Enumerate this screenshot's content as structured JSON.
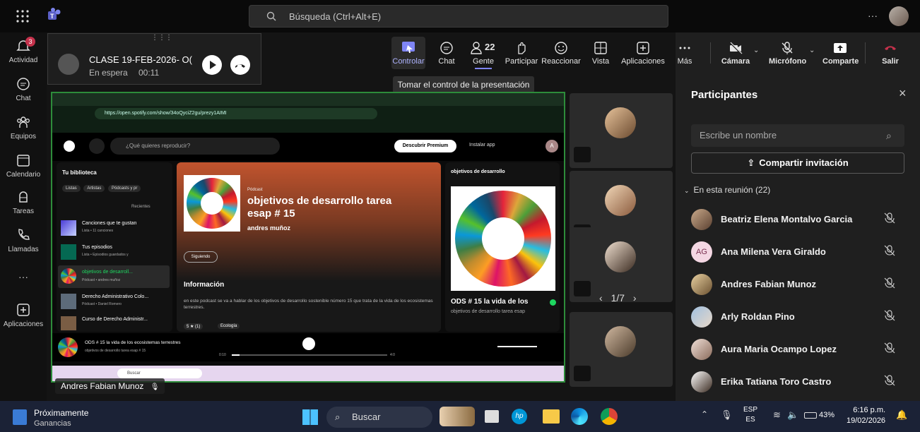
{
  "topbar": {
    "search_placeholder": "Búsqueda (Ctrl+Alt+E)",
    "more": "···"
  },
  "rail": {
    "items": [
      {
        "label": "Actividad",
        "badge": "3"
      },
      {
        "label": "Chat"
      },
      {
        "label": "Equipos"
      },
      {
        "label": "Calendario"
      },
      {
        "label": "Tareas"
      },
      {
        "label": "Llamadas"
      },
      {
        "label": "···"
      },
      {
        "label": "Aplicaciones"
      }
    ]
  },
  "held_call": {
    "title": "CLASE 19-FEB-2026- O(",
    "status": "En espera",
    "timer": "00:11"
  },
  "call_controls": {
    "controlar": "Controlar",
    "chat": "Chat",
    "gente": "Gente",
    "gente_count": "22",
    "participar": "Participar",
    "reaccionar": "Reaccionar",
    "vista": "Vista",
    "aplicaciones": "Aplicaciones",
    "mas": "Más",
    "camara": "Cámara",
    "microfono": "Micrófono",
    "comparte": "Comparte",
    "salir": "Salir",
    "tooltip": "Tomar el control de la presentación"
  },
  "presenter_label": "Andres Fabian Munoz",
  "gallery": {
    "page": "1/7"
  },
  "participants": {
    "title": "Participantes",
    "search_placeholder": "Escribe un nombre",
    "invite": "Compartir invitación",
    "section": "En esta reunión (22)",
    "list": [
      {
        "name": "Beatriz Elena Montalvo Garcia",
        "initials": ""
      },
      {
        "name": "Ana Milena Vera Giraldo",
        "initials": "AG"
      },
      {
        "name": "Andres Fabian Munoz",
        "initials": ""
      },
      {
        "name": "Arly Roldan Pino",
        "initials": ""
      },
      {
        "name": "Aura Maria Ocampo Lopez",
        "initials": ""
      },
      {
        "name": "Erika Tatiana Toro Castro",
        "initials": ""
      }
    ]
  },
  "shared_screen": {
    "url": "https://open.spotify.com/show/34oQyciZ2gu/prezy1AIMI",
    "search_placeholder": "¿Qué quieres reproducir?",
    "premium": "Descubrir Premium",
    "install": "Instalar app",
    "library_title": "Tu biblioteca",
    "filters": [
      "Listas",
      "Artistas",
      "Pódcasts y pr"
    ],
    "recent": "Recientes",
    "library": [
      {
        "title": "Canciones que te gustan",
        "sub": "Lista • 11 canciones"
      },
      {
        "title": "Tus episodios",
        "sub": "Lista • Episodios guardados y"
      },
      {
        "title": "objetivos de desarroll...",
        "sub": "Pódcast • andres muñoz"
      },
      {
        "title": "Derecho Administrativo Colo...",
        "sub": "Pódcast • Daniel Romero"
      },
      {
        "title": "Curso de Derecho Administr...",
        "sub": ""
      }
    ],
    "podcast_kind": "Pódcast",
    "podcast_title": "objetivos de desarrollo tarea esap # 15",
    "podcast_author": "andres muñoz",
    "following": "Siguiendo",
    "info_title": "Información",
    "info_text": "en este podcast se va a hablar de los objetivos de desarrollo sostenible número 15 que trata de la vida de los ecosistemas terrestres.",
    "rating": "5 ★ (1)",
    "tag": "Ecología",
    "side_title": "objetivos de desarrollo",
    "episode_title": "ODS # 15 la vida de los",
    "episode_sub": "objetivos de desarrollo tarea esap",
    "now_playing": "ODS # 15 la vida de los ecosistemas terrestres",
    "now_playing_sub": "objetivos de desarrollo tarea esap # 15",
    "time_start": "0:10",
    "time_end": "4:0",
    "inner_search": "Buscar"
  },
  "taskbar": {
    "weather_title": "Próximamente",
    "weather_sub": "Ganancias",
    "search": "Buscar",
    "lang1": "ESP",
    "lang2": "ES",
    "battery": "43%",
    "time": "6:16 p.m.",
    "date": "19/02/2026"
  },
  "colors": {
    "accent": "#7f85f5",
    "hangup": "#c4314b",
    "share_border": "#2d8c3a"
  }
}
